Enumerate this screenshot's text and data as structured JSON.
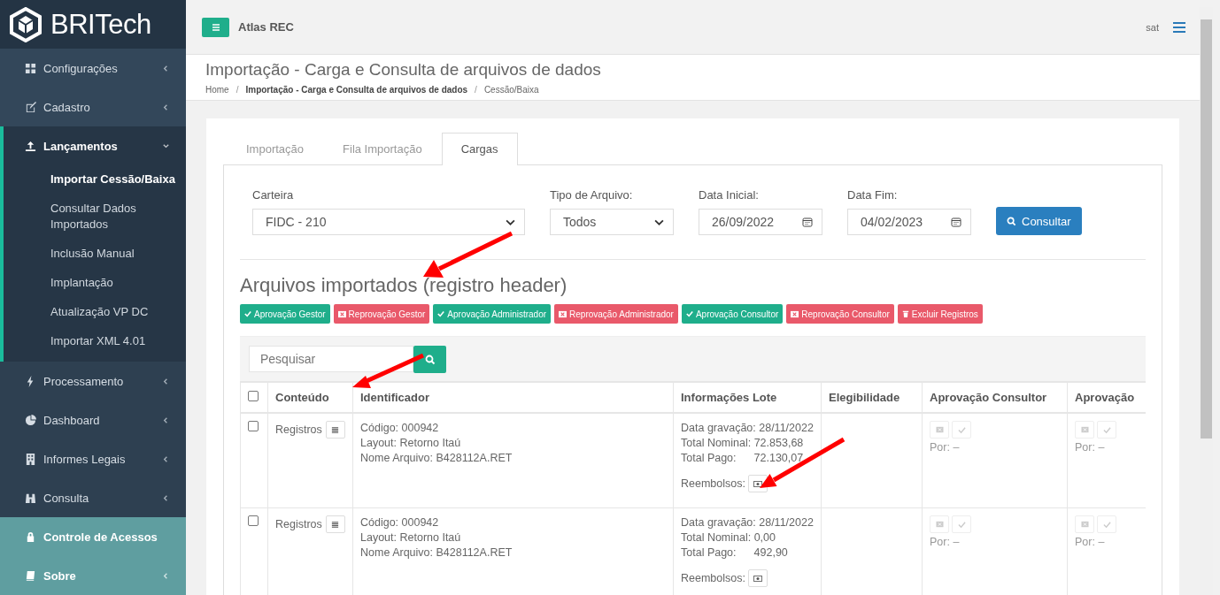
{
  "brand": {
    "name": "BRITech"
  },
  "topbar": {
    "app_name": "Atlas REC",
    "user": "sat"
  },
  "sidebar": {
    "items": [
      {
        "label": "Configurações",
        "expanded": false,
        "highlighted": false
      },
      {
        "label": "Cadastro",
        "expanded": false,
        "highlighted": false
      },
      {
        "label": "Lançamentos",
        "expanded": true,
        "highlighted": false,
        "children": [
          {
            "label": "Importar Cessão/Baixa",
            "selected": true
          },
          {
            "label": "Consultar Dados Importados",
            "selected": false
          },
          {
            "label": "Inclusão Manual",
            "selected": false
          },
          {
            "label": "Implantação",
            "selected": false
          },
          {
            "label": "Atualização VP DC",
            "selected": false
          },
          {
            "label": "Importar XML 4.01",
            "selected": false
          }
        ]
      },
      {
        "label": "Processamento",
        "expanded": false,
        "highlighted": false
      },
      {
        "label": "Dashboard",
        "expanded": false,
        "highlighted": false
      },
      {
        "label": "Informes Legais",
        "expanded": false,
        "highlighted": false
      },
      {
        "label": "Consulta",
        "expanded": false,
        "highlighted": false
      },
      {
        "label": "Controle de Acessos",
        "highlighted": true
      },
      {
        "label": "Sobre",
        "expanded": false,
        "highlighted": true
      }
    ]
  },
  "page_header": {
    "title": "Importação - Carga e Consulta de arquivos de dados",
    "separator": "/",
    "breadcrumb": [
      {
        "label": "Home",
        "bold": false
      },
      {
        "label": "Importação - Carga e Consulta de arquivos de dados",
        "bold": true
      },
      {
        "label": "Cessão/Baixa",
        "bold": false
      }
    ]
  },
  "tabs": [
    {
      "label": "Importação",
      "selected": false
    },
    {
      "label": "Fila Importação",
      "selected": false
    },
    {
      "label": "Cargas",
      "selected": true
    }
  ],
  "filters": [
    {
      "label": "Carteira",
      "value": "FIDC - 210",
      "kind": "select"
    },
    {
      "label": "Tipo de Arquivo:",
      "value": "Todos",
      "kind": "select"
    },
    {
      "label": "Data Inicial:",
      "value": "26/09/2022",
      "kind": "date"
    },
    {
      "label": "Data Fim:",
      "value": "04/02/2023",
      "kind": "date"
    }
  ],
  "consult_button": "Consultar",
  "section_title": "Arquivos importados (registro header)",
  "actions": [
    {
      "label": "Aprovação Gestor",
      "kind": "approve"
    },
    {
      "label": "Reprovação Gestor",
      "kind": "reject"
    },
    {
      "label": "Aprovação Administrador",
      "kind": "approve"
    },
    {
      "label": "Reprovação Administrador",
      "kind": "reject"
    },
    {
      "label": "Aprovação Consultor",
      "kind": "approve"
    },
    {
      "label": "Reprovação Consultor",
      "kind": "reject"
    },
    {
      "label": "Excluir Registros",
      "kind": "delete"
    }
  ],
  "search": {
    "placeholder": "Pesquisar"
  },
  "table": {
    "select_all_checked": false,
    "columns": [
      "Conteúdo",
      "Identificador",
      "Informações Lote",
      "Elegibilidade",
      "Aprovação Consultor",
      "Aprovação"
    ],
    "rows": [
      {
        "checked": false,
        "content": "Registros",
        "identifier": [
          "Código: 000942",
          "Layout: Retorno Itaú",
          "Nome Arquivo: B428112A.RET"
        ],
        "lote": [
          "Data gravação: 28/11/2022",
          "Total Nominal: 72.853,68"
        ],
        "paid_label": "Total Pago:",
        "paid_value": "72.130,07",
        "refunds": "Reembolsos:",
        "approvals": [
          "Por: –",
          "Por: –"
        ]
      },
      {
        "checked": false,
        "content": "Registros",
        "identifier": [
          "Código: 000942",
          "Layout: Retorno Itaú",
          "Nome Arquivo: B428112A.RET"
        ],
        "lote": [
          "Data gravação: 28/11/2022",
          "Total Nominal: 0,00"
        ],
        "paid_label": "Total Pago:",
        "paid_value": "492,90",
        "refunds": "Reembolsos:",
        "approvals": [
          "Por: –",
          "Por: –"
        ]
      }
    ]
  }
}
